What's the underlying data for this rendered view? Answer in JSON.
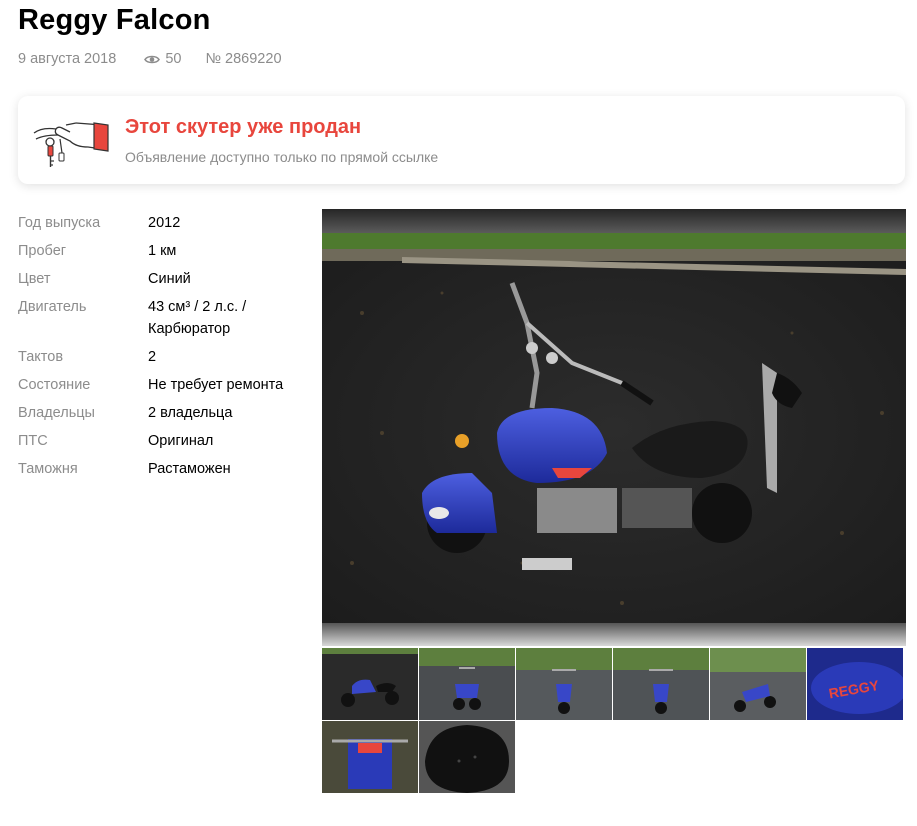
{
  "listing": {
    "title": "Reggy Falcon",
    "date": "9 августа 2018",
    "views": "50",
    "number": "№ 2869220"
  },
  "sold_notice": {
    "title": "Этот скутер уже продан",
    "subtitle": "Объявление доступно только по прямой ссылке",
    "icon": "keys-in-hand-icon",
    "accent_color": "#e8463d"
  },
  "specs": [
    {
      "label": "Год выпуска",
      "value": "2012"
    },
    {
      "label": "Пробег",
      "value": "1 км"
    },
    {
      "label": "Цвет",
      "value": "Синий"
    },
    {
      "label": "Двигатель",
      "value": "43 см³ / 2 л.с. / Карбюратор"
    },
    {
      "label": "Тактов",
      "value": "2"
    },
    {
      "label": "Состояние",
      "value": "Не требует ремонта"
    },
    {
      "label": "Владельцы",
      "value": "2 владельца"
    },
    {
      "label": "ПТС",
      "value": "Оригинал"
    },
    {
      "label": "Таможня",
      "value": "Растаможен"
    }
  ],
  "gallery": {
    "main_photo": "blue mini motorcycle on wet asphalt",
    "thumbnail_count": 8,
    "tank_logo": "REGGY"
  }
}
